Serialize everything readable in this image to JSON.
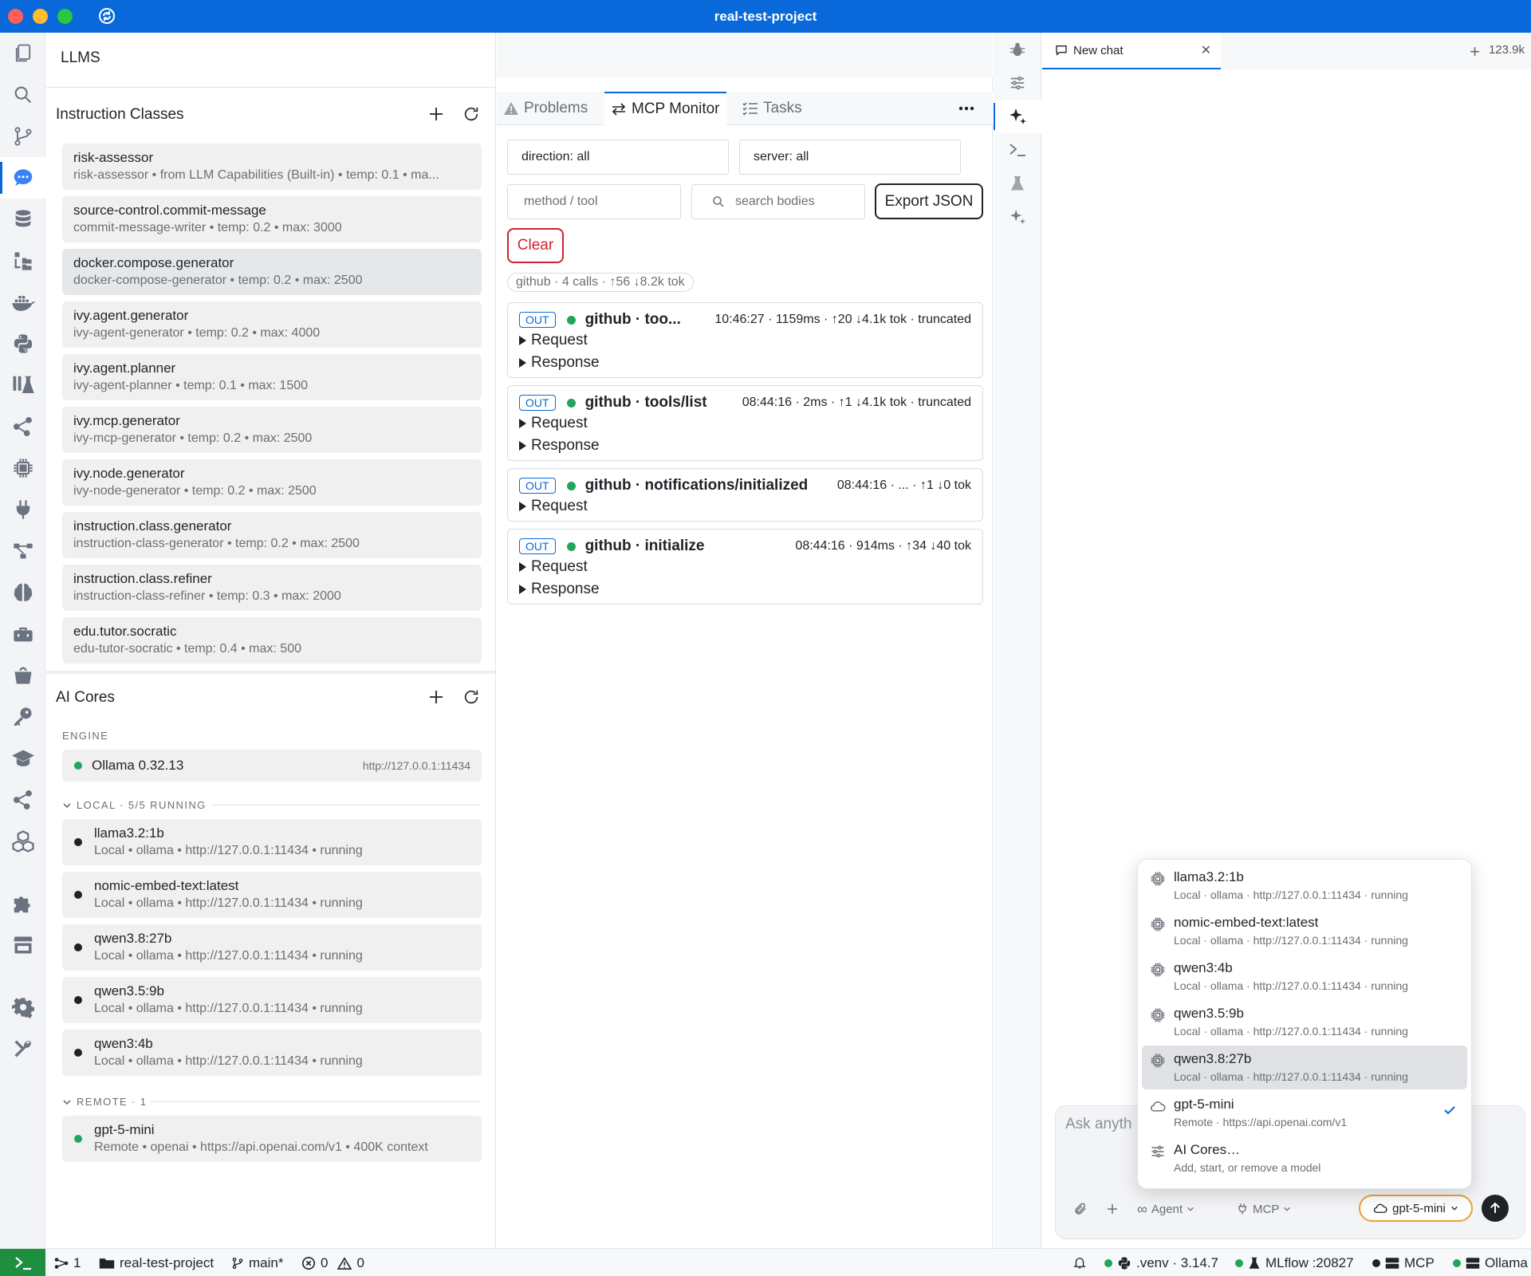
{
  "window": {
    "title": "real-test-project"
  },
  "activity_bar": {
    "items": [
      "files-icon",
      "search-icon",
      "source-control-icon",
      "chat-icon",
      "database-icon",
      "folders-icon",
      "docker-icon",
      "python-icon",
      "flask-icon",
      "graph-icon",
      "cpu-icon",
      "plug-icon",
      "workflow-icon",
      "brain-icon",
      "toolbox-icon",
      "bucket-icon",
      "key-icon",
      "graduation-cap-icon",
      "share-icon",
      "cubes-icon",
      "puzzle-icon",
      "store-icon",
      "settings-icon",
      "wrench-icon"
    ]
  },
  "left_panel": {
    "title": "LLMS",
    "instruction_classes": {
      "title": "Instruction Classes",
      "items": [
        {
          "name": "risk-assessor",
          "detail": "risk-assessor • from LLM Capabilities (Built-in) • temp: 0.1 • ma..."
        },
        {
          "name": "source-control.commit-message",
          "detail": "commit-message-writer • temp: 0.2 • max: 3000"
        },
        {
          "name": "docker.compose.generator",
          "detail": "docker-compose-generator • temp: 0.2 • max: 2500"
        },
        {
          "name": "ivy.agent.generator",
          "detail": "ivy-agent-generator • temp: 0.2 • max: 4000"
        },
        {
          "name": "ivy.agent.planner",
          "detail": "ivy-agent-planner • temp: 0.1 • max: 1500"
        },
        {
          "name": "ivy.mcp.generator",
          "detail": "ivy-mcp-generator • temp: 0.2 • max: 2500"
        },
        {
          "name": "ivy.node.generator",
          "detail": "ivy-node-generator • temp: 0.2 • max: 2500"
        },
        {
          "name": "instruction.class.generator",
          "detail": "instruction-class-generator • temp: 0.2 • max: 2500"
        },
        {
          "name": "instruction.class.refiner",
          "detail": "instruction-class-refiner • temp: 0.3 • max: 2000"
        },
        {
          "name": "edu.tutor.socratic",
          "detail": "edu-tutor-socratic • temp: 0.4 • max: 500"
        }
      ]
    },
    "ai_cores": {
      "title": "AI Cores",
      "engine_label": "ENGINE",
      "engine": {
        "name": "Ollama 0.32.13",
        "url": "http://127.0.0.1:11434"
      },
      "local_label": "LOCAL · 5/5 RUNNING",
      "local": [
        {
          "name": "llama3.2:1b",
          "detail": "Local • ollama • http://127.0.0.1:11434 • running"
        },
        {
          "name": "nomic-embed-text:latest",
          "detail": "Local • ollama • http://127.0.0.1:11434 • running"
        },
        {
          "name": "qwen3.8:27b",
          "detail": "Local • ollama • http://127.0.0.1:11434 • running"
        },
        {
          "name": "qwen3.5:9b",
          "detail": "Local • ollama • http://127.0.0.1:11434 • running"
        },
        {
          "name": "qwen3:4b",
          "detail": "Local • ollama • http://127.0.0.1:11434 • running"
        }
      ],
      "remote_label": "REMOTE · 1",
      "remote": [
        {
          "name": "gpt-5-mini",
          "detail": "Remote • openai • https://api.openai.com/v1 • 400K context"
        }
      ]
    }
  },
  "middle_panel": {
    "tabs": [
      "Problems",
      "MCP Monitor",
      "Tasks"
    ],
    "filters": {
      "direction": "direction: all",
      "server": "server: all",
      "method_placeholder": "method / tool",
      "search_placeholder": "search bodies"
    },
    "export_label": "Export JSON",
    "clear_label": "Clear",
    "summary": "github · 4 calls · ↑56 ↓8.2k tok",
    "calls": [
      {
        "direction": "OUT",
        "name": "github · too...",
        "meta": "10:46:27 · 1159ms · ↑20 ↓4.1k tok · truncated",
        "rows": [
          "Request",
          "Response"
        ]
      },
      {
        "direction": "OUT",
        "name": "github · tools/list",
        "meta": "08:44:16 · 2ms · ↑1 ↓4.1k tok · truncated",
        "rows": [
          "Request",
          "Response"
        ]
      },
      {
        "direction": "OUT",
        "name": "github · notifications/initialized",
        "meta": "08:44:16 · ... · ↑1 ↓0 tok",
        "rows": [
          "Request"
        ]
      },
      {
        "direction": "OUT",
        "name": "github · initialize",
        "meta": "08:44:16 · 914ms · ↑34 ↓40 tok",
        "rows": [
          "Request",
          "Response"
        ]
      }
    ]
  },
  "chat": {
    "tab_label": "New chat",
    "token_count": "123.9k",
    "placeholder": "Ask anyth",
    "agent_label": "Agent",
    "mcp_label": "MCP",
    "model_label": "gpt-5-mini",
    "model_menu": [
      {
        "name": "llama3.2:1b",
        "detail": "Local · ollama · http://127.0.0.1:11434 · running",
        "icon": "cpu-icon"
      },
      {
        "name": "nomic-embed-text:latest",
        "detail": "Local · ollama · http://127.0.0.1:11434 · running",
        "icon": "cpu-icon"
      },
      {
        "name": "qwen3:4b",
        "detail": "Local · ollama · http://127.0.0.1:11434 · running",
        "icon": "cpu-icon"
      },
      {
        "name": "qwen3.5:9b",
        "detail": "Local · ollama · http://127.0.0.1:11434 · running",
        "icon": "cpu-icon"
      },
      {
        "name": "qwen3.8:27b",
        "detail": "Local · ollama · http://127.0.0.1:11434 · running",
        "icon": "cpu-icon"
      },
      {
        "name": "gpt-5-mini",
        "detail": "Remote · https://api.openai.com/v1",
        "icon": "cloud-icon"
      },
      {
        "name": "AI Cores…",
        "detail": "Add, start, or remove a model",
        "icon": "sliders-icon"
      }
    ]
  },
  "status_bar": {
    "ports": "1",
    "project": "real-test-project",
    "branch": "main*",
    "errors": "0",
    "warnings": "0",
    "python": ".venv · 3.14.7",
    "mlflow": "MLflow :20827",
    "mcp": "MCP",
    "ollama": "Ollama"
  },
  "colors": {
    "accent": "#0969da",
    "running": "#22a45a",
    "danger": "#cf222e",
    "model_pill_border": "#e8a23a"
  }
}
